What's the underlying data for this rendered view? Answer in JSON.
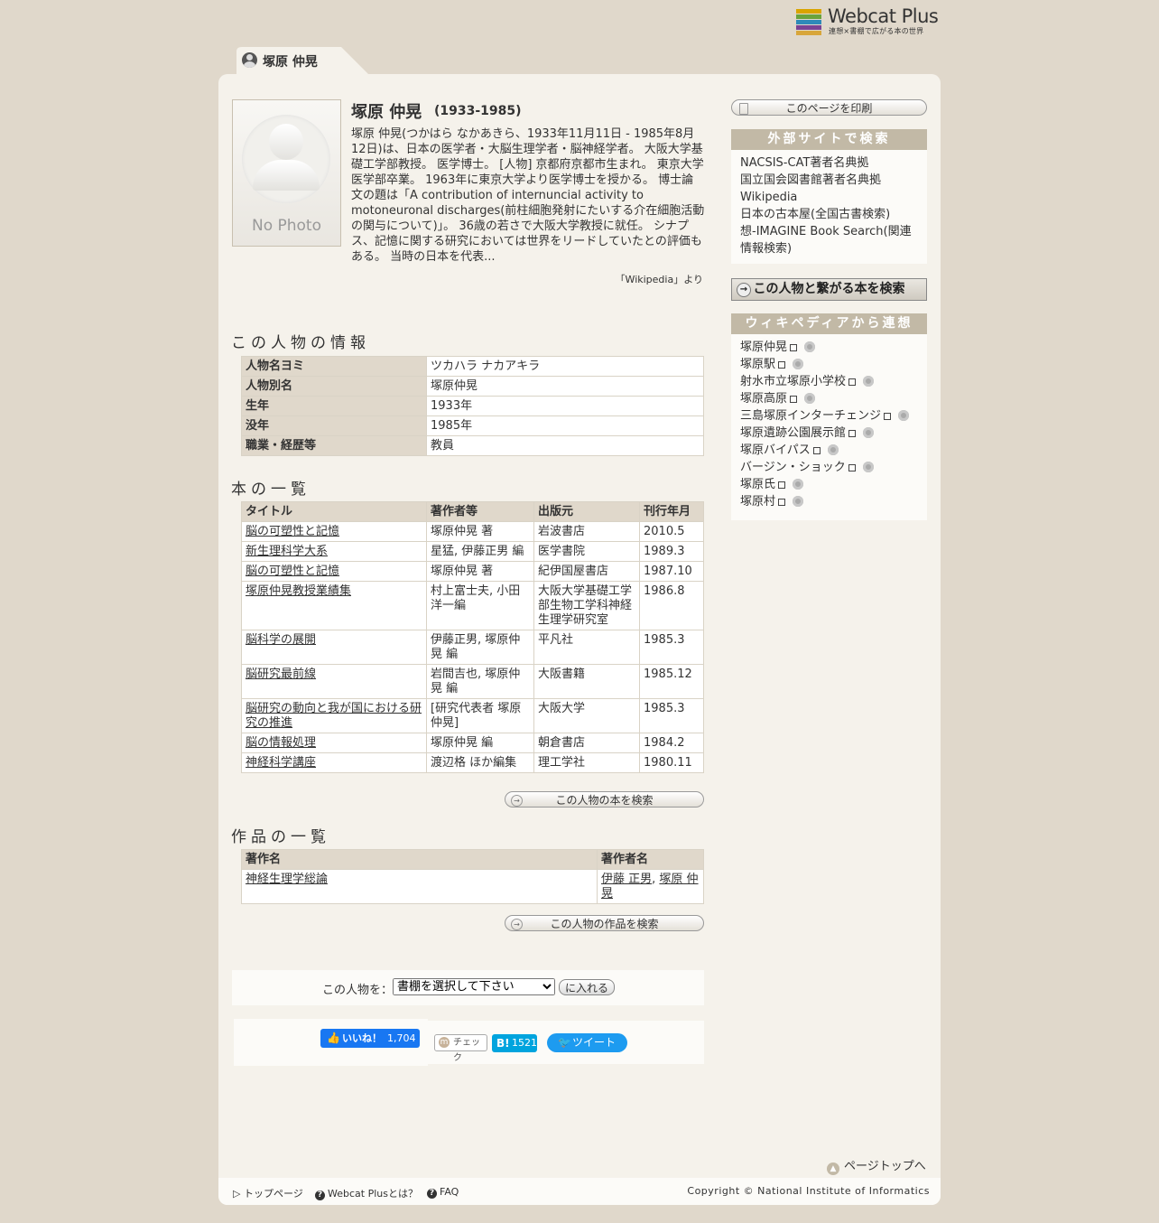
{
  "logo": {
    "name": "Webcat Plus",
    "tagline": "連想×書棚で広がる本の世界",
    "colors": [
      "#d9a400",
      "#6aa33c",
      "#2e8ab9",
      "#7a4394",
      "#d8a63b"
    ]
  },
  "person": {
    "name": "塚原 仲晃",
    "dates": "(1933-1985)",
    "photo_label": "No Photo",
    "description": "塚原 仲晃(つかはら なかあきら、1933年11月11日 - 1985年8月12日)は、日本の医学者・大脳生理学者・脳神経学者。 大阪大学基礎工学部教授。 医学博士。 [人物] 京都府京都市生まれ。 東京大学医学部卒業。 1963年に東京大学より医学博士を授かる。 博士論文の題は「A contribution of internuncial activity to motoneuronal discharges(前柱細胞発射にたいする介在細胞活動の関与について)」。 36歳の若さで大阪大学教授に就任。 シナプス、記憶に関する研究においては世界をリードしていたとの評価もある。 当時の日本を代表...",
    "source": "「Wikipedia」より"
  },
  "info": {
    "heading": "この人物の情報",
    "rows": [
      {
        "label": "人物名ヨミ",
        "value": "ツカハラ ナカアキラ"
      },
      {
        "label": "人物別名",
        "value": "塚原仲晃"
      },
      {
        "label": "生年",
        "value": "1933年"
      },
      {
        "label": "没年",
        "value": "1985年"
      },
      {
        "label": "職業・経歴等",
        "value": "教員"
      }
    ]
  },
  "books": {
    "heading": "本の一覧",
    "columns": [
      "タイトル",
      "著作者等",
      "出版元",
      "刊行年月"
    ],
    "rows": [
      [
        "脳の可塑性と記憶",
        "塚原仲晃 著",
        "岩波書店",
        "2010.5"
      ],
      [
        "新生理科学大系",
        "星猛, 伊藤正男 編",
        "医学書院",
        "1989.3"
      ],
      [
        "脳の可塑性と記憶",
        "塚原仲晃 著",
        "紀伊国屋書店",
        "1987.10"
      ],
      [
        "塚原仲晃教授業績集",
        "村上富士夫, 小田洋一編",
        "大阪大学基礎工学部生物工学科神経生理学研究室",
        "1986.8"
      ],
      [
        "脳科学の展開",
        "伊藤正男, 塚原仲晃 編",
        "平凡社",
        "1985.3"
      ],
      [
        "脳研究最前線",
        "岩間吉也, 塚原仲晃 編",
        "大阪書籍",
        "1985.12"
      ],
      [
        "脳研究の動向と我が国における研究の推進",
        "[研究代表者 塚原仲晃]",
        "大阪大学",
        "1985.3"
      ],
      [
        "脳の情報処理",
        "塚原仲晃 編",
        "朝倉書店",
        "1984.2"
      ],
      [
        "神経科学講座",
        "渡辺格 ほか編集",
        "理工学社",
        "1980.11"
      ]
    ],
    "search_button": "この人物の本を検索"
  },
  "works": {
    "heading": "作品の一覧",
    "columns": [
      "著作名",
      "著作者名"
    ],
    "rows": [
      {
        "title": "神経生理学総論",
        "author1": "伊藤 正男",
        "sep": ", ",
        "author2": "塚原 仲晃"
      }
    ],
    "search_button": "この人物の作品を検索"
  },
  "shelf": {
    "label": "この人物を：",
    "select_value": "書棚を選択して下さい",
    "button": "に入れる"
  },
  "social": {
    "like_label": "いいね！",
    "like_count": "1,704",
    "mixi_label": "チェック",
    "hatena_label": "B!",
    "hatena_count": "1521",
    "tweet_label": "ツイート"
  },
  "sidebar": {
    "print_button": "このページを印刷",
    "external_heading": "外部サイトで検索",
    "external_links": [
      "NACSIS-CAT著者名典拠",
      "国立国会図書館著者名典拠",
      "Wikipedia",
      "日本の古本屋(全国古書検索)",
      "想-IMAGINE Book Search(関連情報検索)"
    ],
    "related_button": "この人物と繋がる本を検索",
    "wiki_heading": "ウィキペディアから連想",
    "wiki_links": [
      "塚原仲晃",
      "塚原駅",
      "射水市立塚原小学校",
      "塚原高原",
      "三島塚原インターチェンジ",
      "塚原遺跡公園展示館",
      "塚原バイパス",
      "バージン・ショック",
      "塚原氏",
      "塚原村"
    ]
  },
  "pagetop": "ページトップへ",
  "footer": {
    "links": [
      "トップページ",
      "Webcat Plusとは？",
      "FAQ"
    ],
    "copyright": "Copyright © National Institute of Informatics"
  }
}
